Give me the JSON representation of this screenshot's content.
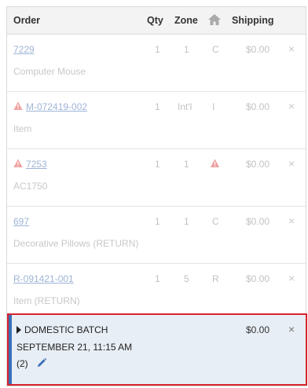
{
  "header": {
    "order": "Order",
    "qty": "Qty",
    "zone": "Zone",
    "home_icon": "home-icon",
    "shipping": "Shipping"
  },
  "rows": [
    {
      "order": "7229",
      "desc": "Computer Mouse",
      "qty": "1",
      "zone": "1",
      "type": "C",
      "shipping": "$0.00",
      "warning": false
    },
    {
      "order": "M-072419-002",
      "desc": "Item",
      "qty": "1",
      "zone": "Int'l",
      "type": "I",
      "shipping": "$0.00",
      "warning": true
    },
    {
      "order": "7253",
      "desc": "AC1750",
      "qty": "1",
      "zone": "1",
      "type": "",
      "shipping": "$0.00",
      "warning": true,
      "type_icon": "warning-icon"
    },
    {
      "order": "697",
      "desc": "Decorative Pillows (RETURN)",
      "qty": "1",
      "zone": "1",
      "type": "C",
      "shipping": "$0.00",
      "warning": false
    },
    {
      "order": "R-091421-001",
      "desc": "Item (RETURN)",
      "qty": "1",
      "zone": "5",
      "type": "R",
      "shipping": "$0.00",
      "warning": false
    }
  ],
  "close_glyph": "×",
  "batch": {
    "title": "DOMESTIC BATCH",
    "date": "SEPTEMBER 21, 11:15 AM",
    "count": "(2)",
    "amount": "$0.00",
    "close_glyph": "×"
  },
  "colors": {
    "warning": "#f0a0a0",
    "link": "#9fb4d6",
    "batch_border": "#d9232d",
    "batch_bg": "#e8eef5",
    "accent": "#3b6fb8"
  }
}
